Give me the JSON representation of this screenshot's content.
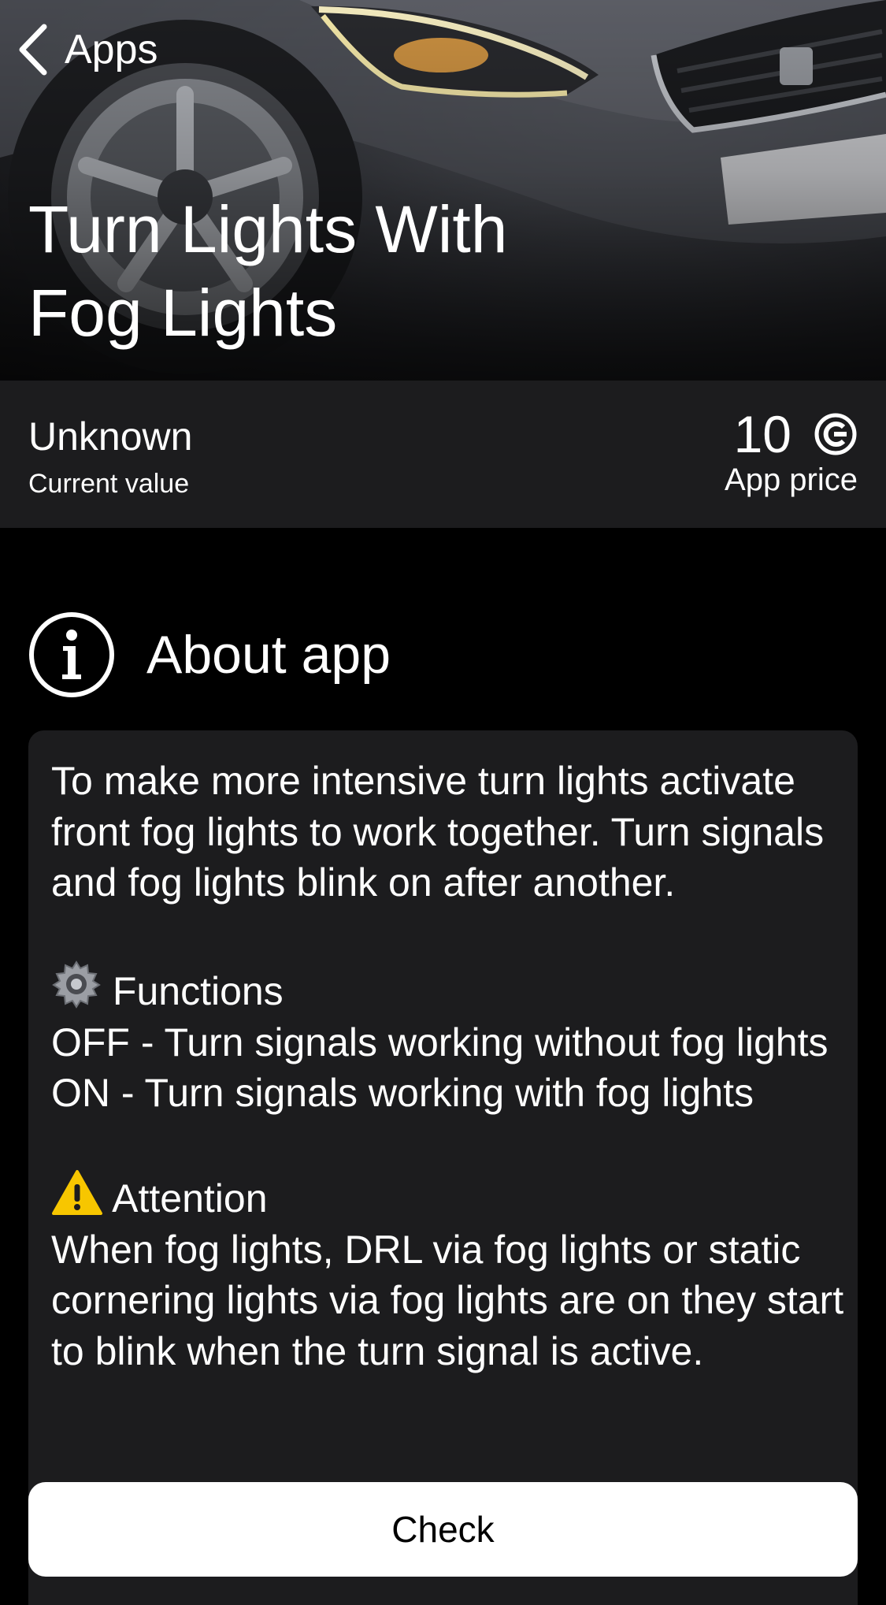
{
  "nav": {
    "back_label": "Apps"
  },
  "page": {
    "title_line1": "Turn Lights With",
    "title_line2": "Fog Lights"
  },
  "info": {
    "current_value": "Unknown",
    "current_value_label": "Current value",
    "price": "10",
    "price_label": "App price",
    "price_icon": "coin-icon"
  },
  "about": {
    "title": "About app",
    "icon": "info-icon",
    "intro": "To make more intensive turn lights activate front fog lights to work together. Turn signals and fog lights blink on after another.",
    "functions_title": "Functions",
    "functions_icon": "gear-icon",
    "function_off": "OFF - Turn signals working without fog lights",
    "function_on": "ON - Turn signals working with fog lights",
    "attention_title": "Attention",
    "attention_icon": "warning-icon",
    "attention_text": "When fog lights, DRL via fog lights or static cornering lights via fog lights are on they start to blink when the turn signal is active."
  },
  "actions": {
    "check_label": "Check"
  },
  "colors": {
    "background": "#000000",
    "card": "#1c1c1e",
    "button": "#ffffff",
    "text": "#ffffff"
  }
}
